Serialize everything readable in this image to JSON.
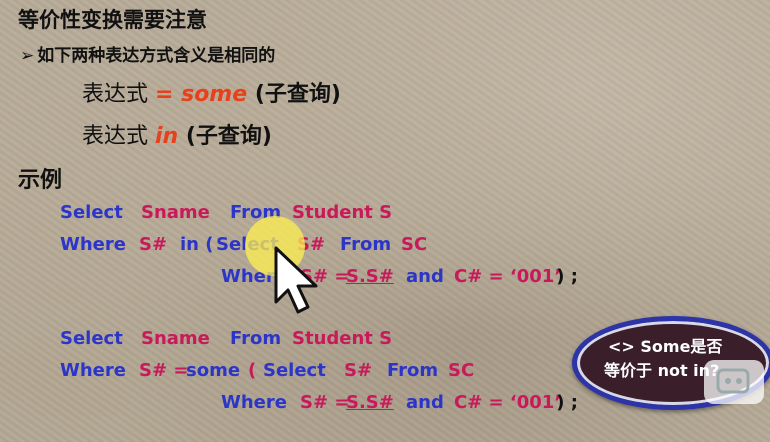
{
  "slide": {
    "title": "等价性变换需要注意",
    "bullet": {
      "arrow": "➢",
      "text": "如下两种表达方式含义是相同的"
    },
    "expressions": [
      {
        "prefix": "表达式 ",
        "keyword": "= some",
        "suffix": " (子查询)"
      },
      {
        "prefix": "表达式 ",
        "keyword": "in",
        "suffix": " (子查询)"
      }
    ],
    "example_heading": "示例"
  },
  "code1": {
    "line1": {
      "kw1": "Select",
      "col": "Sname",
      "kw2": "From",
      "table": "Student S"
    },
    "line2": {
      "kw1": "Where",
      "col": "S#",
      "kw2": "in (",
      "kw3": "Select",
      "col2": "S#",
      "kw4": "From",
      "table": "SC"
    },
    "line3": {
      "kw1": "Where",
      "col": "S# = ",
      "ref": "S.S#",
      "and": "and",
      "cond": "C# = ‘001’",
      "end": " ) ;"
    }
  },
  "code2": {
    "line1": {
      "kw1": "Select",
      "col": "Sname",
      "kw2": "From",
      "table": "Student S"
    },
    "line2": {
      "kw1": "Where",
      "col": "S# = ",
      "kw2": "some",
      "paren": "(",
      "kw3": "Select",
      "col2": "S#",
      "kw4": "From",
      "table": "SC"
    },
    "line3": {
      "kw1": "Where",
      "col": "S# = ",
      "ref": "S.S#",
      "and": "and",
      "cond": "C# = ‘001’",
      "end": " ) ;"
    }
  },
  "tooltip": {
    "line1": "<> Some是否",
    "line2": "等价于 not in?"
  },
  "icons": {
    "cursor": "mouse-pointer-icon",
    "bullet": "arrow-bullet-icon"
  },
  "colors": {
    "keyword_blue": "#2b35c8",
    "identifier_pink": "#c8195a",
    "accent_red": "#e8401a"
  }
}
